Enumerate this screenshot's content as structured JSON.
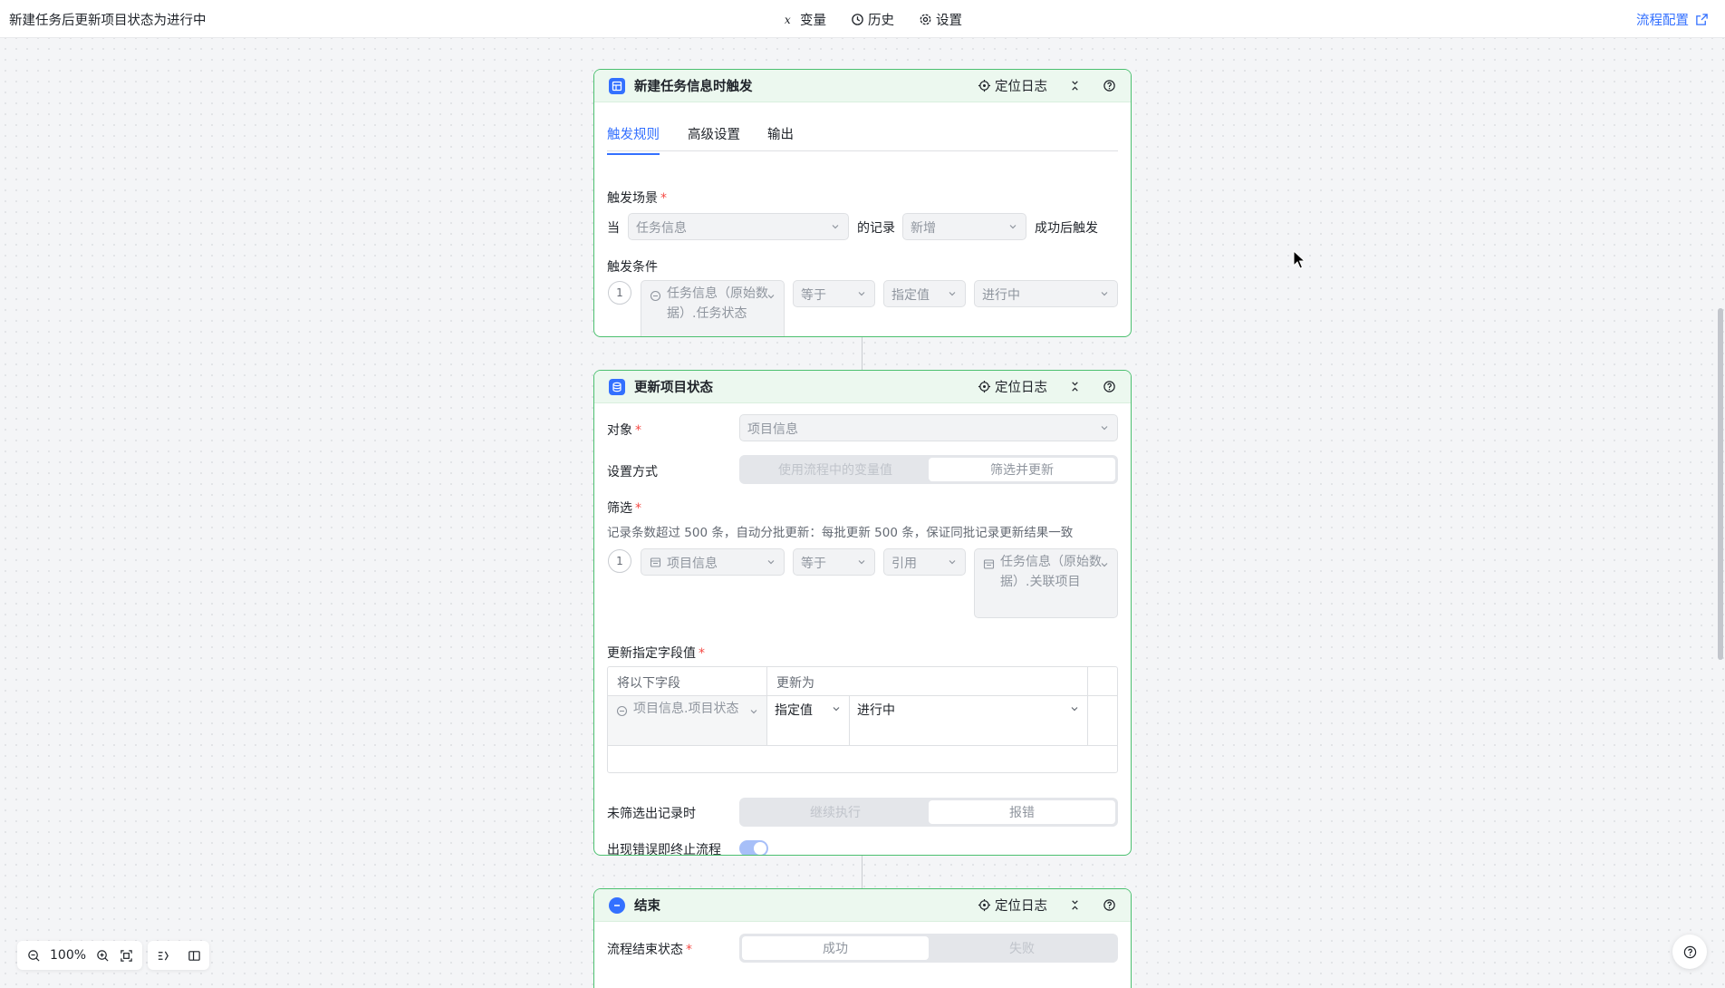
{
  "topbar": {
    "title": "新建任务后更新项目状态为进行中",
    "variables": "变量",
    "history": "历史",
    "settings": "设置",
    "flow_config": "流程配置"
  },
  "trigger": {
    "title": "新建任务信息时触发",
    "locate_log": "定位日志",
    "tabs": [
      "触发规则",
      "高级设置",
      "输出"
    ],
    "scene_label": "触发场景",
    "when": "当",
    "table_value": "任务信息",
    "of_record": "的记录",
    "event_value": "新增",
    "after_success": "成功后触发",
    "condition_label": "触发条件",
    "cond_index": "1",
    "cond_field": "任务信息（原始数据）.任务状态",
    "cond_op": "等于",
    "cond_type": "指定值",
    "cond_value": "进行中"
  },
  "update": {
    "title": "更新项目状态",
    "locate_log": "定位日志",
    "object_label": "对象",
    "object_value": "项目信息",
    "method_label": "设置方式",
    "method_options": [
      "使用流程中的变量值",
      "筛选并更新"
    ],
    "filter_label": "筛选",
    "filter_note": "记录条数超过 500 条，自动分批更新：每批更新 500 条，保证同批记录更新结果一致",
    "filter_index": "1",
    "filter_field": "项目信息",
    "filter_op": "等于",
    "filter_type": "引用",
    "filter_value": "任务信息（原始数据）.关联项目",
    "fields_label": "更新指定字段值",
    "col_field": "将以下字段",
    "col_update": "更新为",
    "row_field": "项目信息.项目状态",
    "row_type": "指定值",
    "row_value": "进行中",
    "no_record_label": "未筛选出记录时",
    "no_record_options": [
      "继续执行",
      "报错"
    ],
    "stop_on_error_label": "出现错误即终止流程",
    "stop_on_error": true
  },
  "end": {
    "title": "结束",
    "locate_log": "定位日志",
    "status_label": "流程结束状态",
    "status_options": [
      "成功",
      "失败"
    ]
  },
  "zoom": {
    "level": "100%"
  },
  "colors": {
    "accent": "#3370ff",
    "card_border": "#4cc070",
    "required": "#f54a45"
  }
}
